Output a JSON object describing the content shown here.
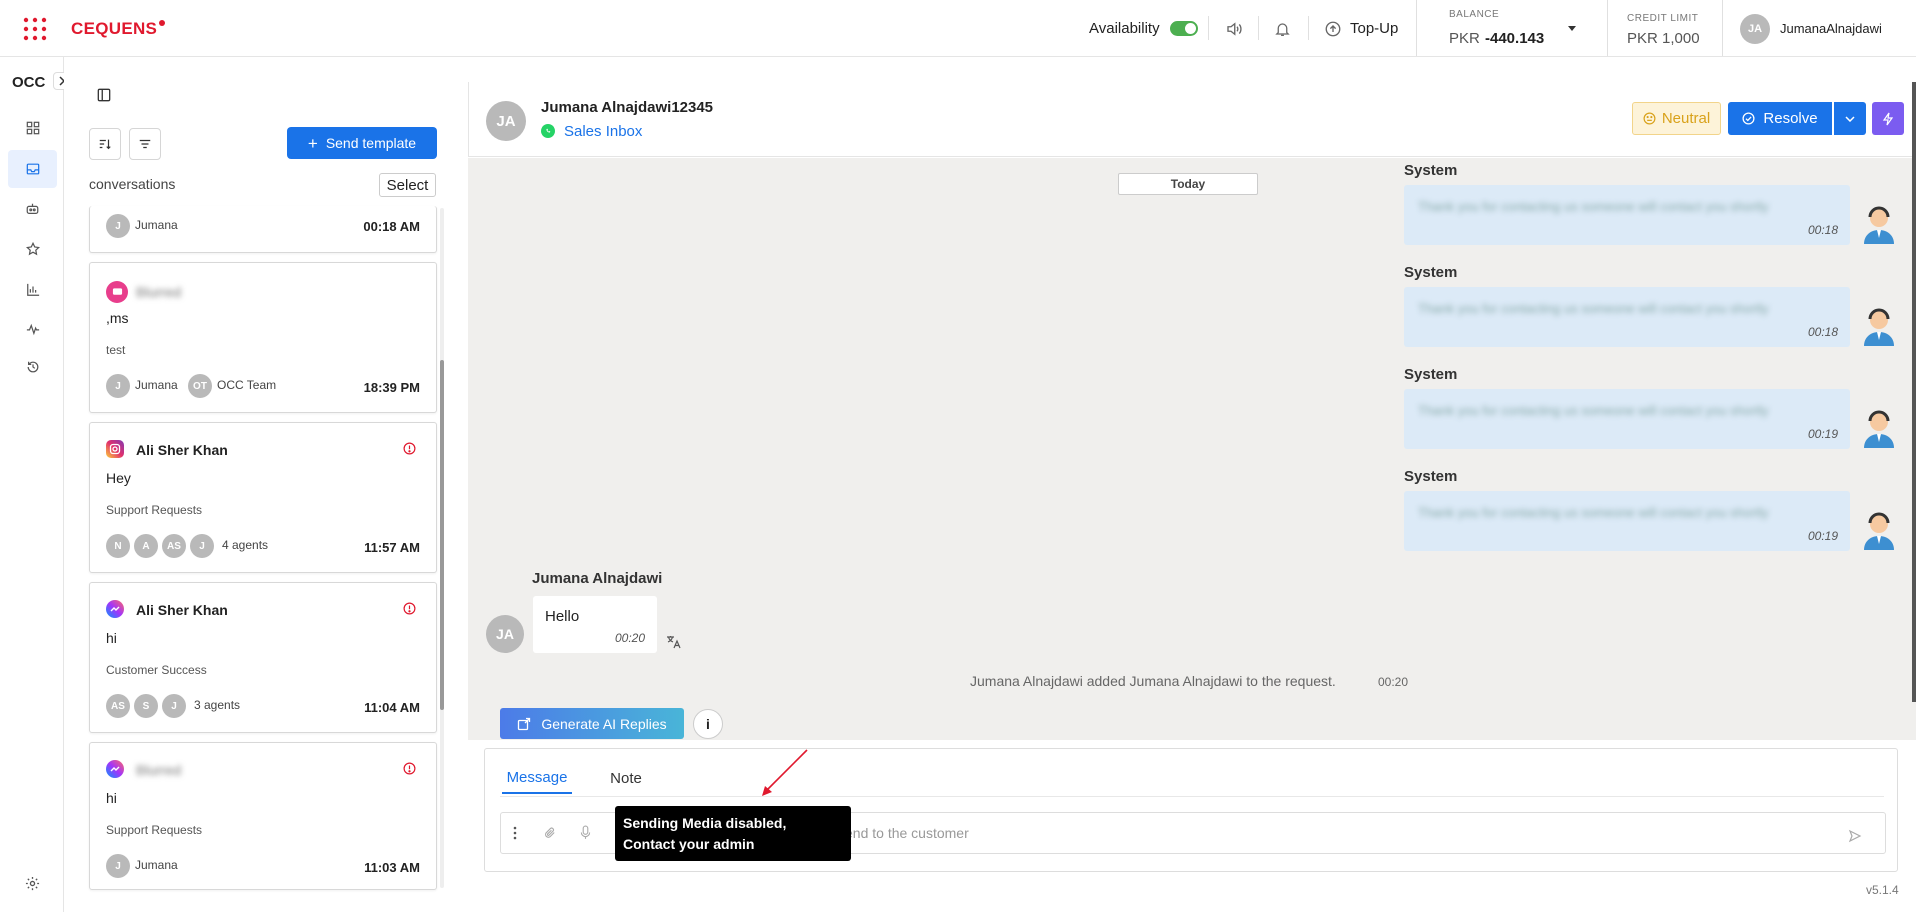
{
  "brand": {
    "name": "CEQUENS"
  },
  "header": {
    "availability_label": "Availability",
    "availability_on": true,
    "topup_label": "Top-Up",
    "balance_label": "BALANCE",
    "balance_currency": "PKR",
    "balance_value": "-440.143",
    "credit_label": "CREDIT LIMIT",
    "credit_value": "PKR 1,000",
    "user_initials": "JA",
    "user_name": "JumanaAlnajdawi"
  },
  "rail": {
    "section_label": "OCC"
  },
  "conversations": {
    "send_template_label": "Send template",
    "header_label": "conversations",
    "select_label": "Select",
    "items": [
      {
        "name": "",
        "preview": "",
        "team": "",
        "agents": [
          {
            "initials": "J",
            "name": "Jumana"
          }
        ],
        "agents_label": "",
        "time": "00:18 AM"
      },
      {
        "name": "Blurred",
        "preview": ",ms",
        "team": "test",
        "agents": [
          {
            "initials": "J",
            "name": "Jumana"
          },
          {
            "initials": "OT",
            "name": "OCC Team"
          }
        ],
        "agents_label": "",
        "time": "18:39 PM"
      },
      {
        "name": "Ali Sher Khan",
        "preview": "Hey",
        "team": "Support Requests",
        "agents": [
          {
            "initials": "N"
          },
          {
            "initials": "A"
          },
          {
            "initials": "AS"
          },
          {
            "initials": "J"
          }
        ],
        "agents_label": "4 agents",
        "time": "11:57 AM"
      },
      {
        "name": "Ali Sher Khan",
        "preview": "hi",
        "team": "Customer Success",
        "agents": [
          {
            "initials": "AS"
          },
          {
            "initials": "S"
          },
          {
            "initials": "J"
          }
        ],
        "agents_label": "3 agents",
        "time": "11:04 AM"
      },
      {
        "name": "Blurred",
        "preview": "hi",
        "team": "Support Requests",
        "agents": [
          {
            "initials": "J",
            "name": "Jumana"
          }
        ],
        "agents_label": "",
        "time": "11:03 AM"
      }
    ]
  },
  "chat": {
    "contact_initials": "JA",
    "contact_name": "Jumana Alnajdawi12345",
    "inbox_name": "Sales Inbox",
    "sentiment_label": "Neutral",
    "resolve_label": "Resolve",
    "date_divider": "Today",
    "system_label": "System",
    "system_messages": [
      {
        "text": "Thank you for contacting us someone will contact you shortly",
        "time": "00:18"
      },
      {
        "text": "Thank you for contacting us someone will contact you shortly",
        "time": "00:18"
      },
      {
        "text": "Thank you for contacting us someone will contact you shortly",
        "time": "00:19"
      },
      {
        "text": "Thank you for contacting us someone will contact you shortly",
        "time": "00:19"
      }
    ],
    "customer_name": "Jumana Alnajdawi",
    "customer_initials": "JA",
    "customer_message": "Hello",
    "customer_time": "00:20",
    "event_text": "Jumana Alnajdawi added Jumana Alnajdawi to the request.",
    "event_time": "00:20",
    "ai_button_label": "Generate AI Replies",
    "info_label": "i"
  },
  "composer": {
    "tab_message": "Message",
    "tab_note": "Note",
    "placeholder_suffix": "end to the customer",
    "tooltip_line1": "Sending Media disabled,",
    "tooltip_line2": "Contact your admin"
  },
  "version": "v5.1.4",
  "colors": {
    "accent": "#1a73e8",
    "brand_red": "#e0192e",
    "neutral_bg": "#fdf3d9",
    "bolt": "#7b5cf0"
  }
}
